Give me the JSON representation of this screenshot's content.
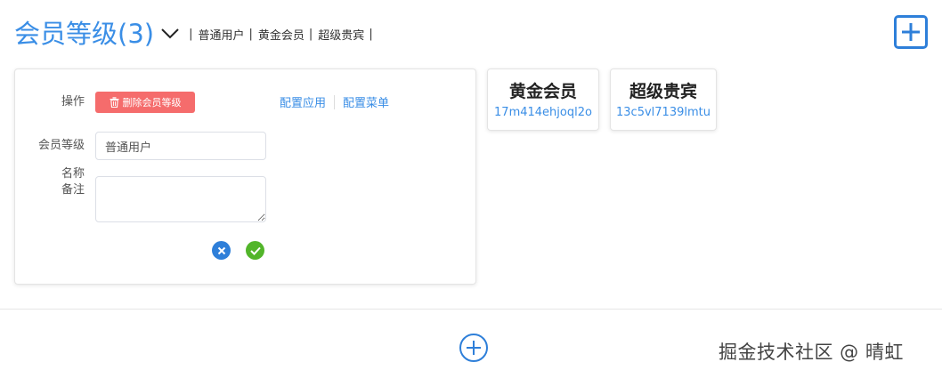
{
  "header": {
    "title": "会员等级(3)",
    "levels": [
      "普通用户",
      "黄金会员",
      "超级贵宾"
    ],
    "separator": "|"
  },
  "form": {
    "action_label": "操作",
    "delete_label": "删除会员等级",
    "configure_app_label": "配置应用",
    "configure_menu_label": "配置菜单",
    "level_name_label_line1": "会员等级",
    "level_name_label_line2": "名称",
    "level_name_value": "普通用户",
    "remark_label": "备注",
    "remark_value": ""
  },
  "cards": [
    {
      "name": "黄金会员",
      "code": "17m414ehjoql2o"
    },
    {
      "name": "超级贵宾",
      "code": "13c5vl7139lmtu"
    }
  ],
  "watermark": "掘金技术社区 @ 晴虹",
  "colors": {
    "accent": "#3a8ee6",
    "danger": "#f56c6c",
    "success": "#52b52a",
    "primary_icon": "#2e7fd9"
  },
  "icons": {
    "chevron": "chevron-down-icon",
    "add_square": "plus-square-icon",
    "trash": "trash-icon",
    "cancel": "close-circle-icon",
    "confirm": "check-circle-icon",
    "add_circle": "plus-circle-icon"
  }
}
